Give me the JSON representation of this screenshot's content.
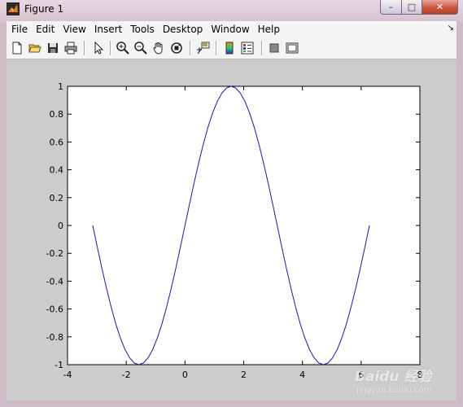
{
  "window": {
    "title": "Figure 1",
    "controls": {
      "minimize": "–",
      "maximize": "□",
      "close": "✕"
    }
  },
  "menubar": {
    "items": [
      "File",
      "Edit",
      "View",
      "Insert",
      "Tools",
      "Desktop",
      "Window",
      "Help"
    ],
    "overflow_glyph": "↘"
  },
  "toolbar": {
    "buttons": [
      "new-figure-icon",
      "open-file-icon",
      "save-icon",
      "print-icon",
      "edit-plot-arrow-icon",
      "zoom-in-icon",
      "zoom-out-icon",
      "pan-hand-icon",
      "rotate-3d-icon",
      "data-cursor-icon",
      "colorbar-icon",
      "legend-icon",
      "hide-plot-tools-icon",
      "show-plot-tools-icon"
    ]
  },
  "watermark": {
    "main": "Baidu 经验",
    "sub": "jingyan.baidu.com"
  },
  "chart_data": {
    "type": "line",
    "function": "sin(x)",
    "x_range": [
      -3.14159,
      6.28318
    ],
    "xlim": [
      -4,
      8
    ],
    "ylim": [
      -1,
      1
    ],
    "xticks": [
      -4,
      -2,
      0,
      2,
      4,
      6,
      8
    ],
    "xtick_labels": [
      "-4",
      "-2",
      "0",
      "2",
      "4",
      "6",
      "8"
    ],
    "yticks": [
      -1,
      -0.8,
      -0.6,
      -0.4,
      -0.2,
      0,
      0.2,
      0.4,
      0.6,
      0.8,
      1
    ],
    "ytick_labels": [
      "-1",
      "-0.8",
      "-0.6",
      "-0.4",
      "-0.2",
      "0",
      "0.2",
      "0.4",
      "0.6",
      "0.8",
      "1"
    ],
    "series": [
      {
        "color": "#1a1aa6",
        "x_start": -3.14159,
        "x_end": 6.28318,
        "samples": 61
      }
    ],
    "grid": false,
    "title": "",
    "xlabel": "",
    "ylabel": ""
  }
}
